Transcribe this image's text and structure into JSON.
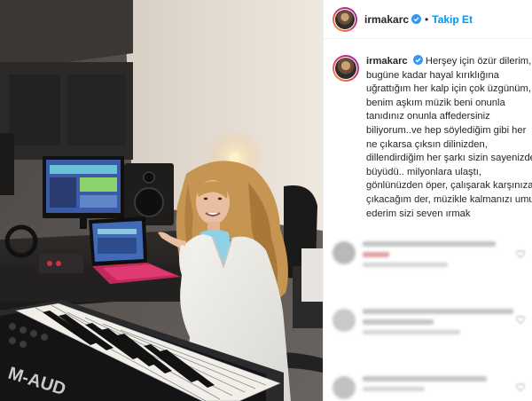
{
  "post": {
    "username": "irmakarc",
    "follow_label": "Takip Et",
    "separator": "•"
  },
  "caption": {
    "username": "irmakarc",
    "lines": [
      "Herşey için özür dilerim,",
      "bugüne kadar hayal kırıklığına",
      "uğrattığım her kalp için çok üzgünüm,",
      "benim aşkım müzik beni onunla",
      "tanıdınız onunla affedersiniz",
      "biliyorum..ve hep söylediğim gibi her",
      "ne çıkarsa çıksın dilinizden,",
      "dillendirdiğim her şarkı sizin sayenizde",
      "büyüdü.. milyonlara ulaştı,",
      "gönlünüzden öper, çalışarak karşınıza",
      "çıkacağım der, müzikle kalmanızı umut",
      "ederim sizi seven ırmak"
    ]
  },
  "photo": {
    "keyboard_brand": "M-AUD"
  },
  "colors": {
    "link": "#0095f6",
    "text": "#262626",
    "verified": "#3897f0"
  }
}
